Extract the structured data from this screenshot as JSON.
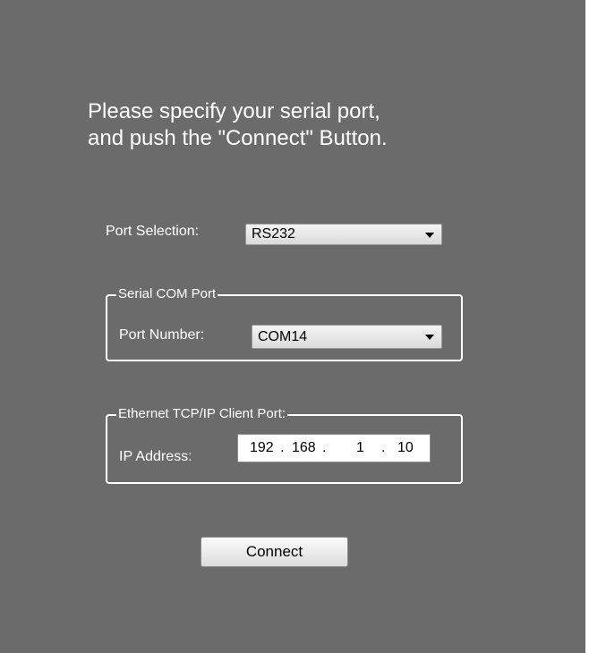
{
  "instruction": {
    "line1": "Please specify your serial port,",
    "line2": "and push the \"Connect\" Button."
  },
  "port_selection": {
    "label": "Port Selection:",
    "value": "RS232"
  },
  "serial_group": {
    "title": "Serial COM Port",
    "port_label": "Port Number:",
    "port_value": "COM14"
  },
  "ethernet_group": {
    "title": "Ethernet TCP/IP Client Port:",
    "ip_label": "IP Address:",
    "ip": {
      "octet1": "192",
      "dot1": ".",
      "octet2": "168",
      "dot2": ".",
      "octet3": "1",
      "dot3": ".",
      "octet4": "10"
    }
  },
  "connect_button": {
    "label": "Connect"
  },
  "colors": {
    "panel_bg": "#6b6b6b",
    "text": "#ffffff"
  },
  "icons": {
    "dropdown_arrow": "chevron-down-icon"
  }
}
